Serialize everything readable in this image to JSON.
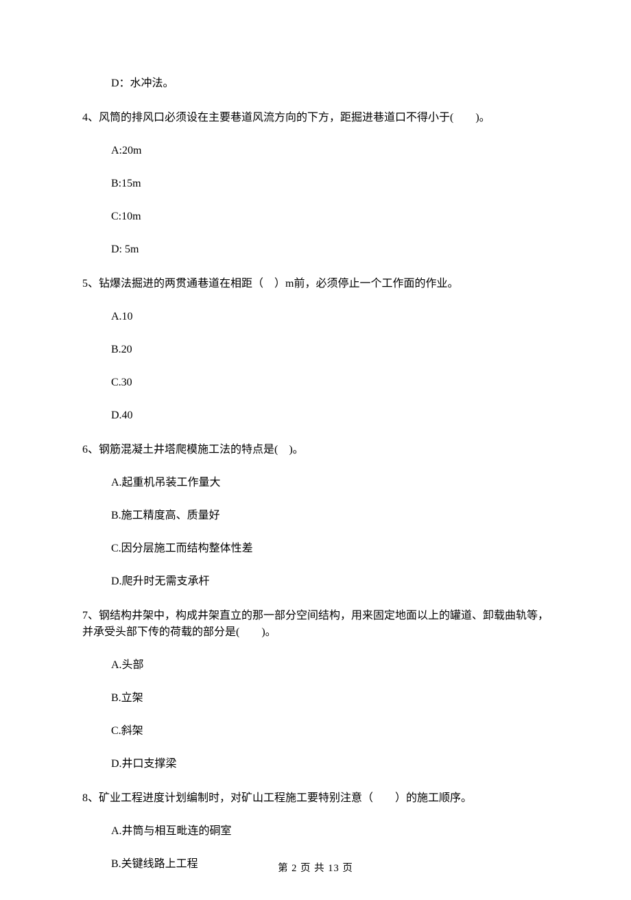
{
  "q3": {
    "options": {
      "D": "D：水冲法。"
    }
  },
  "q4": {
    "stem": "4、风筒的排风口必须设在主要巷道风流方向的下方，距掘进巷道口不得小于(　　)。",
    "options": {
      "A": "A:20m",
      "B": "B:15m",
      "C": "C:10m",
      "D": "D: 5m"
    }
  },
  "q5": {
    "stem": "5、钻爆法掘进的两贯通巷道在相距（　）m前，必须停止一个工作面的作业。",
    "options": {
      "A": "A.10",
      "B": "B.20",
      "C": "C.30",
      "D": "D.40"
    }
  },
  "q6": {
    "stem": "6、钢筋混凝土井塔爬模施工法的特点是(　)。",
    "options": {
      "A": "A.起重机吊装工作量大",
      "B": "B.施工精度高、质量好",
      "C": "C.因分层施工而结构整体性差",
      "D": "D.爬升时无需支承杆"
    }
  },
  "q7": {
    "stem": "7、钢结构井架中，构成井架直立的那一部分空间结构，用来固定地面以上的罐道、卸载曲轨等，并承受头部下传的荷载的部分是(　　)。",
    "options": {
      "A": "A.头部",
      "B": "B.立架",
      "C": "C.斜架",
      "D": "D.井口支撑梁"
    }
  },
  "q8": {
    "stem": "8、矿业工程进度计划编制时，对矿山工程施工要特别注意（　　）的施工顺序。",
    "options": {
      "A": "A.井筒与相互毗连的硐室",
      "B": "B.关键线路上工程"
    }
  },
  "footer": "第 2 页 共 13 页"
}
